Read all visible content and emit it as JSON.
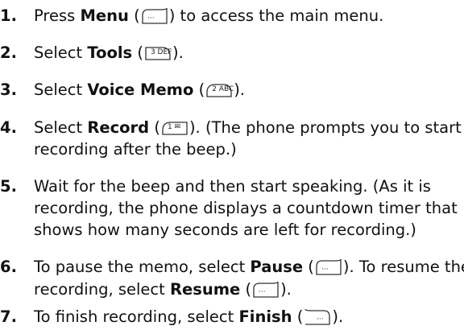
{
  "steps": [
    {
      "num": "1.",
      "pre": "Press ",
      "bold": "Menu",
      "mid": " (",
      "post": ") to access the main menu.",
      "key_icon": "left-softkey-icon"
    },
    {
      "num": "2.",
      "pre": "Select ",
      "bold": "Tools",
      "mid": " (",
      "post": ").",
      "key_icon": "key-3-icon",
      "key_label": "3 DEF"
    },
    {
      "num": "3.",
      "pre": "Select ",
      "bold": "Voice Memo",
      "mid": " (",
      "post": ").",
      "key_icon": "key-2-icon",
      "key_label": "2 ABC"
    },
    {
      "num": "4.",
      "pre": "Select ",
      "bold": "Record",
      "mid": " (",
      "post": "). (The phone prompts you to start",
      "line2": "recording after the beep.)",
      "key_icon": "key-1-icon",
      "key_label": "1 ✉"
    },
    {
      "num": "5.",
      "line1": "Wait for the beep and then start speaking. (As it is",
      "line2": "recording, the phone displays a countdown timer that",
      "line3": "shows how many seconds are left for recording.)"
    },
    {
      "num": "6.",
      "pre": "To pause the memo, select ",
      "bold": "Pause",
      "mid": " (",
      "post": "). To resume the",
      "line2_pre": "recording, select ",
      "line2_bold": "Resume",
      "line2_mid": " (",
      "line2_post": ").",
      "key_icon": "left-softkey-icon"
    },
    {
      "num": "7.",
      "pre": "To finish recording, select ",
      "bold": "Finish",
      "mid": " (",
      "post": ").",
      "key_icon": "right-softkey-icon"
    }
  ]
}
